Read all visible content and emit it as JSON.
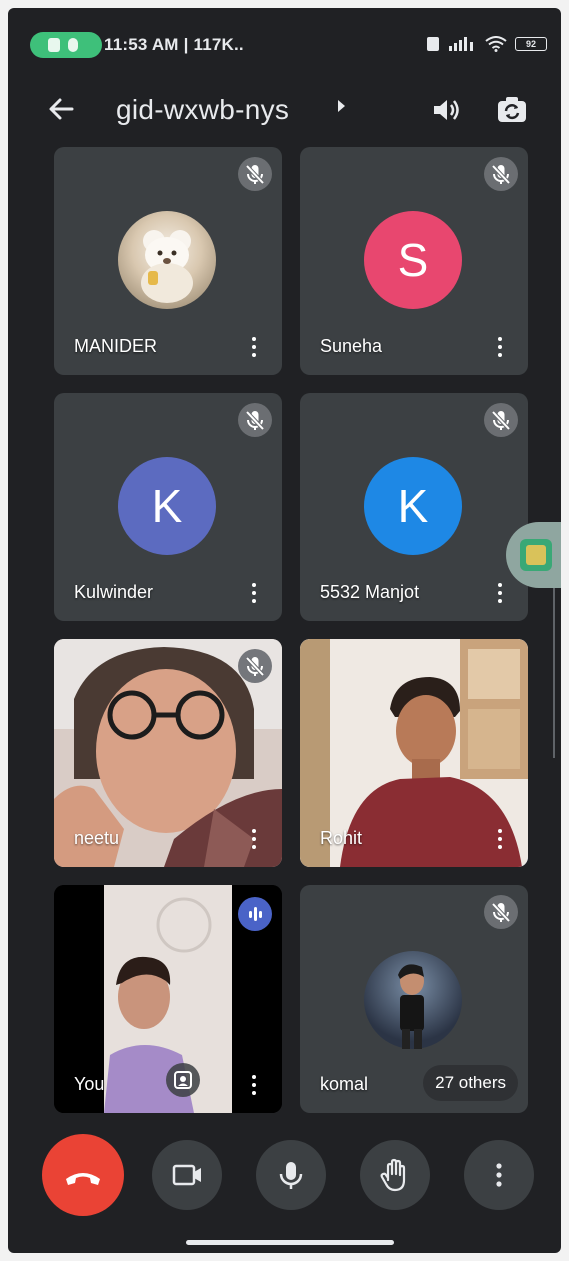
{
  "status_bar": {
    "time_text": "11:53 AM | 117K..",
    "battery": "92",
    "icons": [
      "call-indicator-icon",
      "mic-indicator-icon",
      "sim-icon",
      "signal-icon",
      "wifi-icon",
      "battery-icon"
    ]
  },
  "header": {
    "meeting_code": "gid-wxwb-nys",
    "icons": [
      "back-arrow-icon",
      "dropdown-arrow-icon",
      "speaker-icon",
      "switch-camera-icon"
    ]
  },
  "participants": [
    {
      "name": "MANIDER",
      "tile": "avatar-photo",
      "muted": true
    },
    {
      "name": "Suneha",
      "tile": "initial",
      "initial": "S",
      "color": "#e8476f",
      "muted": true
    },
    {
      "name": "Kulwinder",
      "tile": "initial",
      "initial": "K",
      "color": "#5c6bc0",
      "muted": true
    },
    {
      "name": "5532 Manjot",
      "tile": "initial",
      "initial": "K",
      "color": "#1e88e5",
      "muted": true
    },
    {
      "name": "neetu",
      "tile": "video",
      "muted": true
    },
    {
      "name": "Rohit",
      "tile": "video",
      "muted": false,
      "active": true
    },
    {
      "name": "You",
      "tile": "self-video",
      "muted": false,
      "speaking": true
    },
    {
      "name": "komal",
      "tile": "avatar-photo",
      "muted": true
    }
  ],
  "others_chip": "27 others",
  "controls": [
    {
      "name": "end-call-button",
      "icon": "hang-up-icon",
      "color": "#ea4335"
    },
    {
      "name": "camera-toggle-button",
      "icon": "video-camera-icon"
    },
    {
      "name": "mic-toggle-button",
      "icon": "microphone-icon"
    },
    {
      "name": "raise-hand-button",
      "icon": "hand-icon"
    },
    {
      "name": "more-options-button",
      "icon": "more-vert-icon"
    }
  ],
  "colors": {
    "background": "#202124",
    "tile": "#3c4043",
    "end_call": "#ea4335",
    "call_pill": "#3ec07a",
    "active_border": "#8ab4f8"
  }
}
